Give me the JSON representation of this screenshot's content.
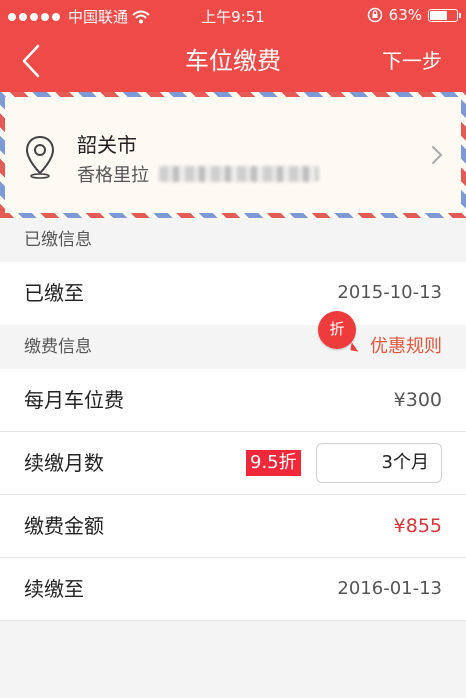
{
  "status_bar": {
    "carrier": "中国联通",
    "time": "上午9:51",
    "battery_pct": "63%"
  },
  "nav": {
    "title": "车位缴费",
    "next_label": "下一步"
  },
  "address": {
    "city": "韶关市",
    "detail_prefix": "香格里拉"
  },
  "paid_info": {
    "section_title": "已缴信息",
    "paid_until_label": "已缴至",
    "paid_until_value": "2015-10-13"
  },
  "payment_info": {
    "section_title": "缴费信息",
    "badge_text": "折",
    "rules_link": "优惠规则",
    "monthly_fee_label": "每月车位费",
    "monthly_fee_value": "¥300",
    "months_label": "续缴月数",
    "discount_tag": "9.5折",
    "months_value": "3个月",
    "amount_label": "缴费金额",
    "amount_value": "¥855",
    "renew_until_label": "续缴至",
    "renew_until_value": "2016-01-13"
  },
  "colors": {
    "brand": "#ee4a48",
    "accent_red": "#d9343a",
    "link": "#e0573e"
  }
}
